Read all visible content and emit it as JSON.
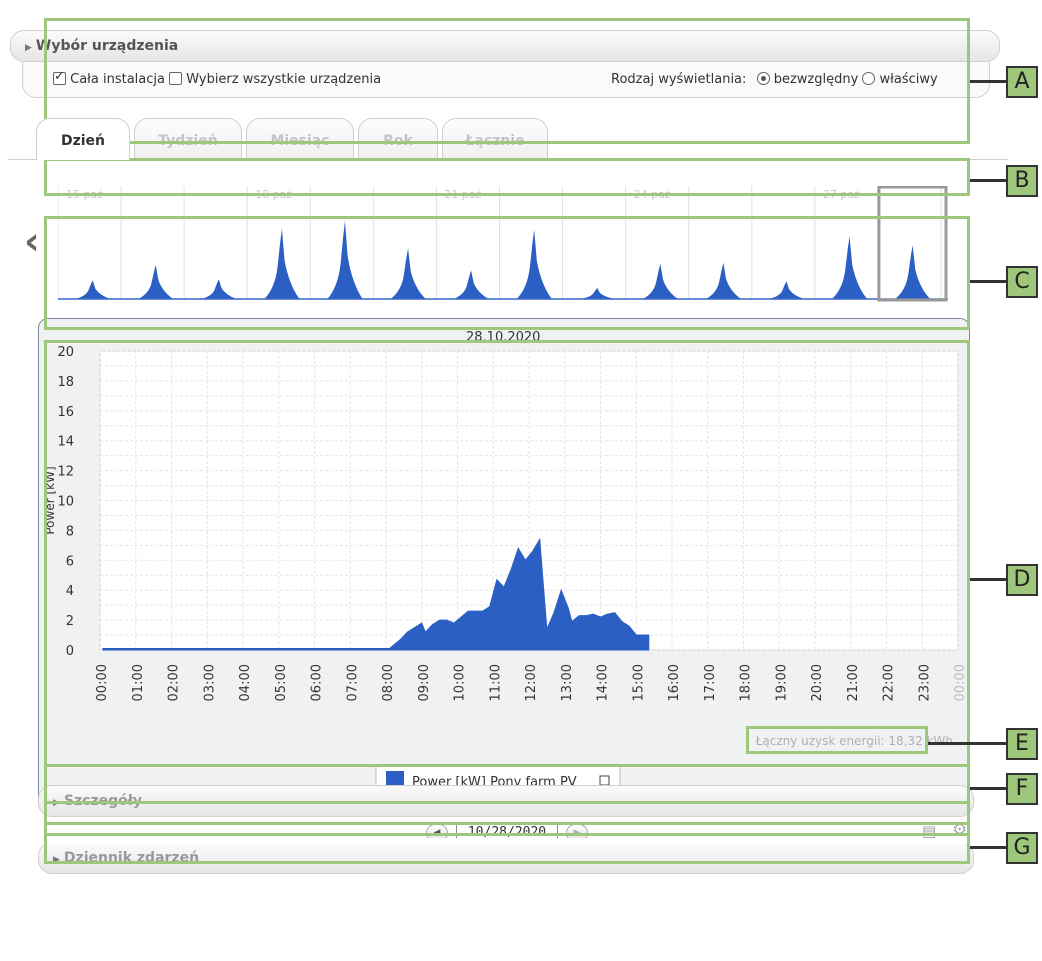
{
  "device_selection": {
    "title": "Wybór urządzenia",
    "whole_installation_label": "Cała instalacja",
    "whole_installation_checked": true,
    "select_all_label": "Wybierz wszystkie urządzenia",
    "select_all_checked": false,
    "display_type_label": "Rodzaj wyświetlania:",
    "absolute_label": "bezwzględny",
    "specific_label": "właściwy",
    "selected_display": "absolute"
  },
  "tabs": [
    {
      "label": "Dzień",
      "active": true
    },
    {
      "label": "Tydzień",
      "active": false
    },
    {
      "label": "Miesiąc",
      "active": false
    },
    {
      "label": "Rok",
      "active": false
    },
    {
      "label": "Łącznie",
      "active": false
    }
  ],
  "overview": {
    "date_labels": [
      "15 paź",
      "18 paź",
      "21 paź",
      "24 paź",
      "27 paź"
    ],
    "day_peaks": [
      0.17,
      0.31,
      0.18,
      0.64,
      0.71,
      0.46,
      0.26,
      0.63,
      0.1,
      0.32,
      0.33,
      0.16,
      0.57,
      0.49
    ],
    "selected_day_index": 13,
    "nav_prev_icon": "chevron-left-icon"
  },
  "chart_data": {
    "type": "area",
    "title": "28.10.2020",
    "xlabel": "",
    "ylabel": "Power [kW]",
    "ylim": [
      0,
      20
    ],
    "yticks": [
      0,
      2,
      4,
      6,
      8,
      10,
      12,
      14,
      16,
      18,
      20
    ],
    "xticks": [
      "00:00",
      "01:00",
      "02:00",
      "03:00",
      "04:00",
      "05:00",
      "06:00",
      "07:00",
      "08:00",
      "09:00",
      "10:00",
      "11:00",
      "12:00",
      "13:00",
      "14:00",
      "15:00",
      "16:00",
      "17:00",
      "18:00",
      "19:00",
      "20:00",
      "21:00",
      "22:00",
      "23:00",
      "00:00"
    ],
    "grid": true,
    "legend_position": "bottom",
    "series": [
      {
        "name": "Power [kW] Pony farm PV",
        "color": "#2b5fc4",
        "x": [
          0.08,
          8.1,
          8.2,
          8.4,
          8.6,
          8.8,
          9.0,
          9.1,
          9.3,
          9.5,
          9.7,
          9.9,
          10.1,
          10.3,
          10.5,
          10.7,
          10.9,
          11.1,
          11.3,
          11.5,
          11.7,
          11.9,
          12.1,
          12.3,
          12.5,
          12.7,
          12.9,
          13.1,
          13.2,
          13.4,
          13.6,
          13.8,
          14.0,
          14.2,
          14.4,
          14.6,
          14.8,
          15.0,
          15.2,
          15.35
        ],
        "y": [
          0.1,
          0.1,
          0.3,
          0.7,
          1.2,
          1.5,
          1.8,
          1.2,
          1.7,
          2.0,
          2.0,
          1.8,
          2.2,
          2.6,
          2.6,
          2.6,
          2.9,
          4.7,
          4.2,
          5.4,
          6.8,
          6.0,
          6.6,
          7.4,
          1.4,
          2.5,
          4.0,
          2.8,
          1.9,
          2.3,
          2.3,
          2.4,
          2.2,
          2.4,
          2.5,
          1.9,
          1.6,
          1.0,
          1.0,
          1.0
        ]
      }
    ]
  },
  "total_energy_text": "Łączny uzysk energii: 18,32 kWh",
  "date_input_value": "10/28/2020",
  "details_title": "Szczegóły",
  "event_log_title": "Dziennik zdarzeń",
  "callouts": [
    "A",
    "B",
    "C",
    "D",
    "E",
    "F",
    "G"
  ],
  "colors": {
    "frame": "#9ec77b",
    "series": "#2b5fc4",
    "panel_border": "#7d8a99"
  },
  "icons": {
    "section_toggle": "triangle-right-icon",
    "export": "export-icon",
    "settings": "gear-icon",
    "next_date": "chevron-right-icon",
    "prev_date": "chevron-left-icon"
  }
}
